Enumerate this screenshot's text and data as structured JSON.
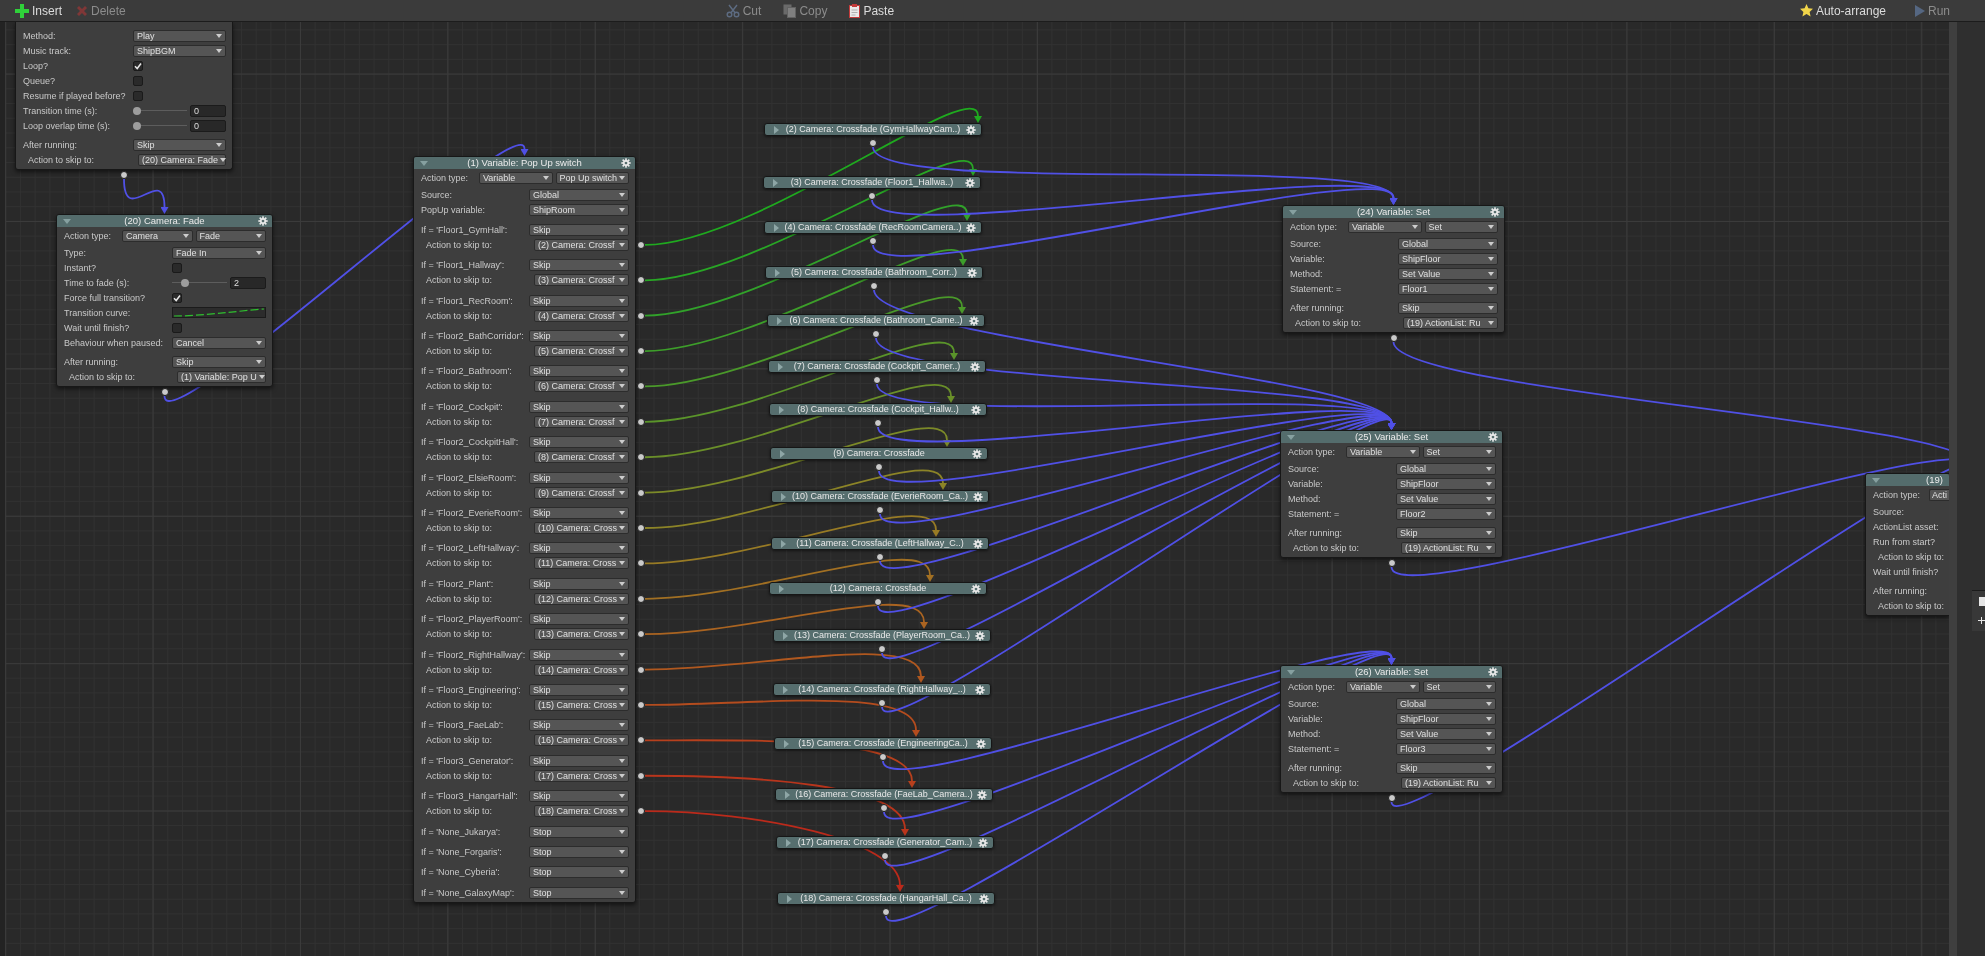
{
  "toolbar": {
    "insert": {
      "label": "Insert",
      "disabled": false
    },
    "delete": {
      "label": "Delete",
      "disabled": true
    },
    "cut": {
      "label": "Cut",
      "disabled": true
    },
    "copy": {
      "label": "Copy",
      "disabled": true
    },
    "paste": {
      "label": "Paste",
      "disabled": false
    },
    "auto_arrange": {
      "label": "Auto-arrange",
      "disabled": false
    },
    "run": {
      "label": "Run",
      "disabled": true
    }
  },
  "nodes": [
    {
      "rows": [
        {
          "kind": "dropdown",
          "label": "Method:",
          "value": "Play"
        },
        {
          "kind": "dropdown",
          "label": "Music track:",
          "value": "ShipBGM"
        },
        {
          "kind": "checkbox",
          "label": "Loop?",
          "checked": true
        },
        {
          "kind": "checkbox",
          "label": "Queue?",
          "checked": false
        },
        {
          "kind": "checkbox",
          "label": "Resume if played before?",
          "checked": false
        },
        {
          "kind": "slider",
          "label": "Transition time (s):",
          "level": 0,
          "value": "0"
        },
        {
          "kind": "slider",
          "label": "Loop overlap time (s):",
          "level": 0,
          "value": "0"
        }
      ],
      "after": [
        {
          "kind": "dropdown",
          "label": "After running:",
          "value": "Skip"
        },
        {
          "kind": "skip",
          "label": "Action to skip to:",
          "value": "(20) Camera: Fade"
        }
      ]
    },
    {
      "title": "(20) Camera: Fade",
      "expanded": true,
      "rows": [
        {
          "kind": "pair",
          "label": "Action type:",
          "values": [
            "Camera",
            "Fade"
          ]
        },
        {
          "kind": "dropdown",
          "label": "Type:",
          "value": "Fade In"
        },
        {
          "kind": "checkbox",
          "label": "Instant?",
          "checked": false
        },
        {
          "kind": "slider",
          "label": "Time to fade (s):",
          "level": 0.2,
          "value": "2"
        },
        {
          "kind": "checkbox",
          "label": "Force full transition?",
          "checked": true
        },
        {
          "kind": "curve",
          "label": "Transition curve:"
        },
        {
          "kind": "checkbox",
          "label": "Wait until finish?",
          "checked": false
        },
        {
          "kind": "dropdown",
          "label": "Behaviour when paused:",
          "value": "Cancel"
        }
      ],
      "after": [
        {
          "kind": "dropdown",
          "label": "After running:",
          "value": "Skip"
        },
        {
          "kind": "skip",
          "label": "Action to skip to:",
          "value": "(1) Variable: Pop U"
        }
      ]
    },
    {
      "title": "(1) Variable: Pop Up switch",
      "expanded": true,
      "rows": [
        {
          "kind": "pair",
          "label": "Action type:",
          "values": [
            "Variable",
            "Pop Up switch"
          ]
        },
        {
          "kind": "dropdown",
          "label": "Source:",
          "value": "Global"
        },
        {
          "kind": "dropdown",
          "label": "PopUp variable:",
          "value": "ShipRoom"
        }
      ],
      "cases": [
        {
          "label": "If = 'Floor1_GymHall':",
          "result": "Skip",
          "skip_label": "Action to skip to:",
          "skip_to": "(2) Camera: Crossf",
          "color": "#1faa1f"
        },
        {
          "label": "If = 'Floor1_Hallway':",
          "result": "Skip",
          "skip_label": "Action to skip to:",
          "skip_to": "(3) Camera: Crossf",
          "color": "#28a625"
        },
        {
          "label": "If = 'Floor1_RecRoom':",
          "result": "Skip",
          "skip_label": "Action to skip to:",
          "skip_to": "(4) Camera: Crossf",
          "color": "#31a22a"
        },
        {
          "label": "If = 'Floor2_BathCorridor':",
          "result": "Skip",
          "skip_label": "Action to skip to:",
          "skip_to": "(5) Camera: Crossf",
          "color": "#3d9e2a"
        },
        {
          "label": "If = 'Floor2_Bathroom':",
          "result": "Skip",
          "skip_label": "Action to skip to:",
          "skip_to": "(6) Camera: Crossf",
          "color": "#4a992a"
        },
        {
          "label": "If = 'Floor2_Cockpit':",
          "result": "Skip",
          "skip_label": "Action to skip to:",
          "skip_to": "(7) Camera: Crossf",
          "color": "#5a942a"
        },
        {
          "label": "If = 'Floor2_CockpitHall':",
          "result": "Skip",
          "skip_label": "Action to skip to:",
          "skip_to": "(8) Camera: Crossf",
          "color": "#6a8f29"
        },
        {
          "label": "If = 'Floor2_ElsieRoom':",
          "result": "Skip",
          "skip_label": "Action to skip to:",
          "skip_to": "(9) Camera: Crossf",
          "color": "#7c8a28"
        },
        {
          "label": "If = 'Floor2_EverieRoom':",
          "result": "Skip",
          "skip_label": "Action to skip to:",
          "skip_to": "(10) Camera: Cross",
          "color": "#8c8427"
        },
        {
          "label": "If = 'Floor2_LeftHallway':",
          "result": "Skip",
          "skip_label": "Action to skip to:",
          "skip_to": "(11) Camera: Cross",
          "color": "#987b25"
        },
        {
          "label": "If = 'Floor2_Plant':",
          "result": "Skip",
          "skip_label": "Action to skip to:",
          "skip_to": "(12) Camera: Cross",
          "color": "#a27023"
        },
        {
          "label": "If = 'Floor2_PlayerRoom':",
          "result": "Skip",
          "skip_label": "Action to skip to:",
          "skip_to": "(13) Camera: Cross",
          "color": "#aa6421"
        },
        {
          "label": "If = 'Floor2_RightHallway':",
          "result": "Skip",
          "skip_label": "Action to skip to:",
          "skip_to": "(14) Camera: Cross",
          "color": "#b0581f"
        },
        {
          "label": "If = 'Floor3_Engineering':",
          "result": "Skip",
          "skip_label": "Action to skip to:",
          "skip_to": "(15) Camera: Cross",
          "color": "#b44c1e"
        },
        {
          "label": "If = 'Floor3_FaeLab':",
          "result": "Skip",
          "skip_label": "Action to skip to:",
          "skip_to": "(16) Camera: Cross",
          "color": "#b7401d"
        },
        {
          "label": "If = 'Floor3_Generator':",
          "result": "Skip",
          "skip_label": "Action to skip to:",
          "skip_to": "(17) Camera: Cross",
          "color": "#b9351c"
        },
        {
          "label": "If = 'Floor3_HangarHall':",
          "result": "Skip",
          "skip_label": "Action to skip to:",
          "skip_to": "(18) Camera: Cross",
          "color": "#bb2a1b"
        },
        {
          "label": "If = 'None_Jukarya':",
          "result": "Stop"
        },
        {
          "label": "If = 'None_Forgaris':",
          "result": "Stop"
        },
        {
          "label": "If = 'None_Cyberia':",
          "result": "Stop"
        },
        {
          "label": "If = 'None_GalaxyMap':",
          "result": "Stop"
        }
      ]
    },
    {
      "title": "(24) Variable: Set",
      "expanded": true,
      "rows": [
        {
          "kind": "pair",
          "label": "Action type:",
          "values": [
            "Variable",
            "Set"
          ]
        },
        {
          "kind": "dropdown",
          "label": "Source:",
          "value": "Global"
        },
        {
          "kind": "dropdown",
          "label": "Variable:",
          "value": "ShipFloor"
        },
        {
          "kind": "dropdown",
          "label": "Method:",
          "value": "Set Value"
        },
        {
          "kind": "dropdown",
          "label": "Statement: =",
          "value": "Floor1"
        }
      ],
      "after": [
        {
          "kind": "dropdown",
          "label": "After running:",
          "value": "Skip"
        },
        {
          "kind": "skip",
          "label": "Action to skip to:",
          "value": "(19) ActionList: Ru"
        }
      ]
    },
    {
      "title": "(25) Variable: Set",
      "expanded": true,
      "rows": [
        {
          "kind": "pair",
          "label": "Action type:",
          "values": [
            "Variable",
            "Set"
          ]
        },
        {
          "kind": "dropdown",
          "label": "Source:",
          "value": "Global"
        },
        {
          "kind": "dropdown",
          "label": "Variable:",
          "value": "ShipFloor"
        },
        {
          "kind": "dropdown",
          "label": "Method:",
          "value": "Set Value"
        },
        {
          "kind": "dropdown",
          "label": "Statement: =",
          "value": "Floor2"
        }
      ],
      "after": [
        {
          "kind": "dropdown",
          "label": "After running:",
          "value": "Skip"
        },
        {
          "kind": "skip",
          "label": "Action to skip to:",
          "value": "(19) ActionList: Ru"
        }
      ]
    },
    {
      "title": "(26) Variable: Set",
      "expanded": true,
      "rows": [
        {
          "kind": "pair",
          "label": "Action type:",
          "values": [
            "Variable",
            "Set"
          ]
        },
        {
          "kind": "dropdown",
          "label": "Source:",
          "value": "Global"
        },
        {
          "kind": "dropdown",
          "label": "Variable:",
          "value": "ShipFloor"
        },
        {
          "kind": "dropdown",
          "label": "Method:",
          "value": "Set Value"
        },
        {
          "kind": "dropdown",
          "label": "Statement: =",
          "value": "Floor3"
        }
      ],
      "after": [
        {
          "kind": "dropdown",
          "label": "After running:",
          "value": "Skip"
        },
        {
          "kind": "skip",
          "label": "Action to skip to:",
          "value": "(19) ActionList: Ru"
        }
      ]
    },
    {
      "title": "(19)",
      "expanded": true,
      "rows": [
        {
          "kind": "pair",
          "label": "Action type:",
          "values": [
            "Acti"
          ]
        },
        {
          "kind": "label",
          "label": "Source:"
        },
        {
          "kind": "label",
          "label": "ActionList asset:"
        },
        {
          "kind": "label",
          "label": "Run from start?"
        },
        {
          "kind": "skip",
          "label": "Action to skip to:"
        },
        {
          "kind": "label",
          "label": "Wait until finish?"
        }
      ],
      "after": [
        {
          "kind": "label",
          "label": "After running:"
        },
        {
          "kind": "skip",
          "label": "Action to skip to:"
        }
      ]
    }
  ],
  "collapsed_nodes": [
    {
      "title": "(2) Camera: Crossfade (GymHallwayCam..)",
      "expanded": false
    },
    {
      "title": "(3) Camera: Crossfade (Floor1_Hallwa..)",
      "expanded": false
    },
    {
      "title": "(4) Camera: Crossfade (RecRoomCamera..)",
      "expanded": false
    },
    {
      "title": "(5) Camera: Crossfade (Bathroom_Corr..)",
      "expanded": false
    },
    {
      "title": "(6) Camera: Crossfade (Bathroom_Came..)",
      "expanded": false
    },
    {
      "title": "(7) Camera: Crossfade (Cockpit_Camer..)",
      "expanded": false
    },
    {
      "title": "(8) Camera: Crossfade (Cockpit_Hallw..)",
      "expanded": false
    },
    {
      "title": "(9) Camera: Crossfade",
      "expanded": false
    },
    {
      "title": "(10) Camera: Crossfade (EverieRoom_Ca..)",
      "expanded": false
    },
    {
      "title": "(11) Camera: Crossfade (LeftHallway_C..)",
      "expanded": false
    },
    {
      "title": "(12) Camera: Crossfade",
      "expanded": false
    },
    {
      "title": "(13) Camera: Crossfade (PlayerRoom_Ca..)",
      "expanded": false
    },
    {
      "title": "(14) Camera: Crossfade (RightHallway_..)",
      "expanded": false
    },
    {
      "title": "(15) Camera: Crossfade (EngineeringCa..)",
      "expanded": false
    },
    {
      "title": "(16) Camera: Crossfade (FaeLab_Camera..)",
      "expanded": false
    },
    {
      "title": "(17) Camera: Crossfade (Generator_Cam..)",
      "expanded": false
    },
    {
      "title": "(18) Camera: Crossfade (HangarHall_Ca..)",
      "expanded": false
    }
  ]
}
